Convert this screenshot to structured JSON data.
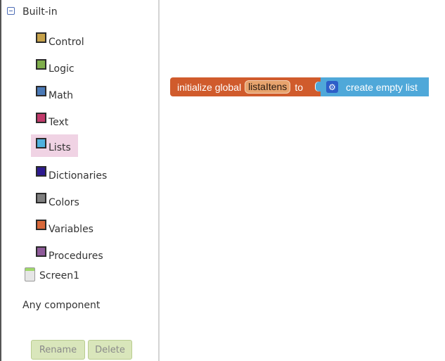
{
  "tree": {
    "builtin_label": "Built-in",
    "categories": [
      {
        "label": "Control",
        "color": "#c7a24a"
      },
      {
        "label": "Logic",
        "color": "#7fae4c"
      },
      {
        "label": "Math",
        "color": "#4a79b6"
      },
      {
        "label": "Text",
        "color": "#c23a6b"
      },
      {
        "label": "Lists",
        "color": "#4fb1de"
      },
      {
        "label": "Dictionaries",
        "color": "#2d1a8f"
      },
      {
        "label": "Colors",
        "color": "#7f7f7f"
      },
      {
        "label": "Variables",
        "color": "#d8683a"
      },
      {
        "label": "Procedures",
        "color": "#8e5a99"
      }
    ],
    "selected_category": "Lists",
    "screen_label": "Screen1",
    "any_component_label": "Any component"
  },
  "buttons": {
    "rename": "Rename",
    "delete": "Delete"
  },
  "workspace": {
    "init_block": {
      "prefix": "initialize global",
      "variable_name": "listaItens",
      "suffix": "to"
    },
    "list_block": {
      "label": "create empty list",
      "icon": "gear-icon"
    }
  }
}
